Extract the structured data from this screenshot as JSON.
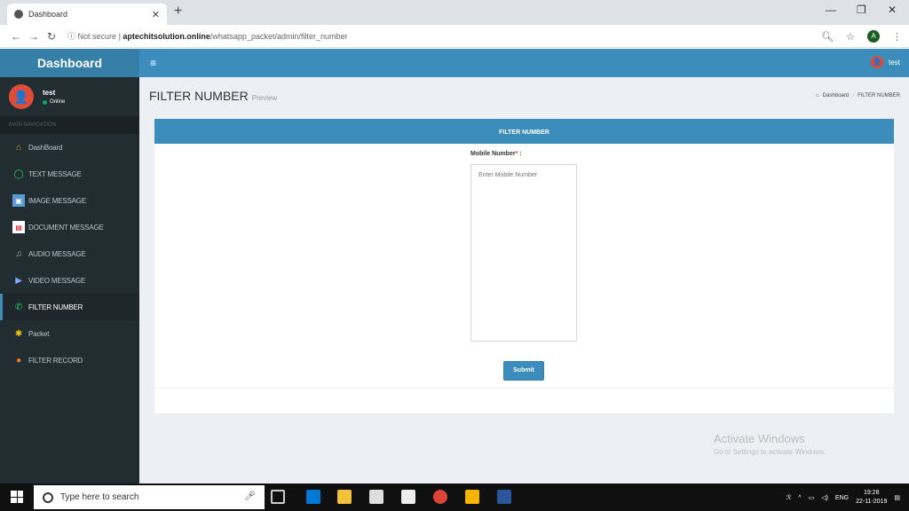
{
  "browser": {
    "tab_title": "Dashboard",
    "not_secure": "Not secure",
    "url_host": "aptechitsolution.online",
    "url_path": "/whatsapp_packet/admin/filter_number"
  },
  "sidebar": {
    "logo": "Dashboard",
    "user_name": "test",
    "user_status": "Online",
    "nav_header": "MAIN NAVIGATION",
    "items": [
      {
        "label": "DashBoard",
        "icon": "home-icon"
      },
      {
        "label": "TEXT MESSAGE",
        "icon": "whatsapp-icon"
      },
      {
        "label": "IMAGE MESSAGE",
        "icon": "image-icon"
      },
      {
        "label": "DOCUMENT MESSAGE",
        "icon": "document-icon"
      },
      {
        "label": "AUDIO MESSAGE",
        "icon": "audio-icon"
      },
      {
        "label": "VIDEO MESSAGE",
        "icon": "video-icon"
      },
      {
        "label": "FILTER NUMBER",
        "icon": "phone-icon"
      },
      {
        "label": "Packet",
        "icon": "packet-icon"
      },
      {
        "label": "FILTER RECORD",
        "icon": "record-icon"
      }
    ]
  },
  "topnav": {
    "user_name": "test"
  },
  "content": {
    "title": "FILTER NUMBER",
    "subtitle": "Preview",
    "breadcrumb": [
      "Dashboard",
      "FILTER NUMBER"
    ],
    "box_title": "FILTER NUMBER",
    "field_label": "Mobile Number",
    "field_required": "*",
    "field_suffix": " :",
    "field_placeholder": "Enter Mobile Number",
    "submit_label": "Submit"
  },
  "watermark": {
    "title": "Activate Windows",
    "subtitle": "Go to Settings to activate Windows."
  },
  "taskbar": {
    "search_placeholder": "Type here to search",
    "lang": "ENG",
    "time": "19:28",
    "date": "22-11-2019"
  },
  "colors": {
    "primary": "#3c8dbc",
    "sidebar": "#222d32",
    "danger": "#dd4b39"
  }
}
